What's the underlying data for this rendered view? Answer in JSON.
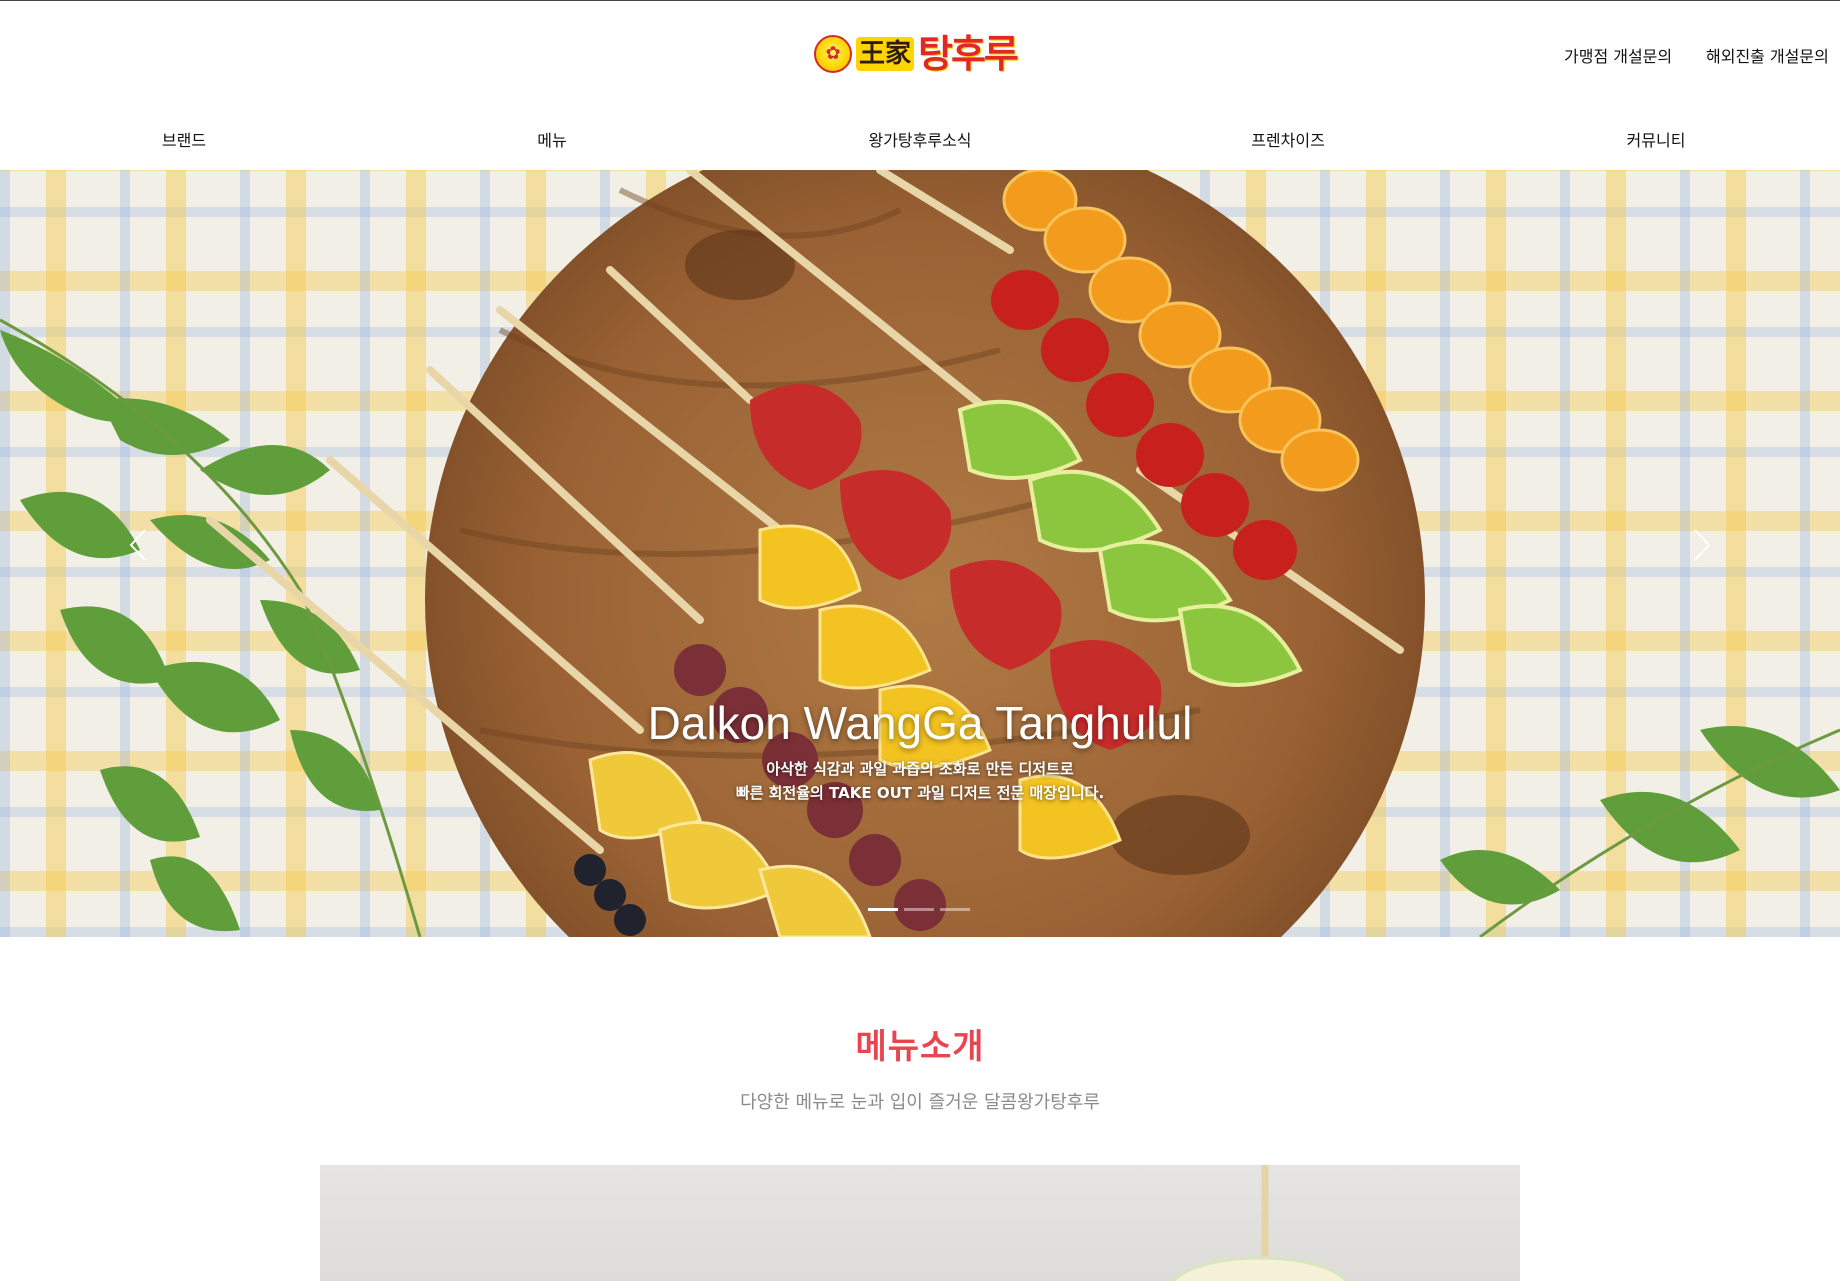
{
  "header": {
    "logo": {
      "han": "王家",
      "name": "탕후루",
      "emblem_icon": "tanghulu-emblem-icon"
    },
    "util_links": [
      {
        "label": "가맹점 개설문의"
      },
      {
        "label": "해외진출 개설문의"
      }
    ],
    "nav": [
      {
        "label": "브랜드"
      },
      {
        "label": "메뉴"
      },
      {
        "label": "왕가탕후루소식"
      },
      {
        "label": "프렌차이즈"
      },
      {
        "label": "커뮤니티"
      }
    ]
  },
  "hero": {
    "title": "Dalkon WangGa Tanghulul",
    "subtitle_line1": "아삭한 식감과 과일 과즙의 조화로 만든 디저트로",
    "subtitle_line2": "빠른 회전율의 TAKE OUT 과일 디저트 전문 매장입니다.",
    "prev_icon": "chevron-left-icon",
    "next_icon": "chevron-right-icon",
    "slide_count": 3,
    "active_slide": 1
  },
  "menu_section": {
    "title": "메뉴소개",
    "subtitle": "다양한 메뉴로 눈과 입이 즐거운 달콤왕가탕후루"
  },
  "colors": {
    "accent": "#e9454f",
    "logo_red": "#e02828",
    "logo_yellow": "#ffd400",
    "subtitle_gray": "#8a8a8a"
  }
}
